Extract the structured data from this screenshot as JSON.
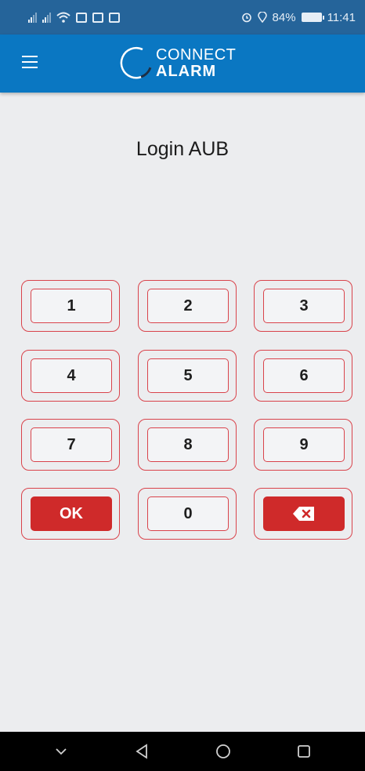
{
  "status_bar": {
    "battery_percent": "84%",
    "time": "11:41"
  },
  "app_bar": {
    "brand_line1": "CONNECT",
    "brand_line2": "ALARM"
  },
  "page": {
    "title": "Login AUB"
  },
  "keypad": {
    "keys": [
      "1",
      "2",
      "3",
      "4",
      "5",
      "6",
      "7",
      "8",
      "9",
      "OK",
      "0"
    ],
    "ok_label": "OK",
    "delete_icon": "backspace-icon",
    "accent_color": "#d9434b",
    "button_fill_color": "#cf2a2a"
  },
  "colors": {
    "status_bar": "#25649a",
    "app_bar": "#0a77c2",
    "background": "#ecedef"
  },
  "nav_bar": {
    "buttons": [
      "chevron-down-icon",
      "back-triangle-icon",
      "home-circle-icon",
      "recents-square-icon"
    ]
  }
}
